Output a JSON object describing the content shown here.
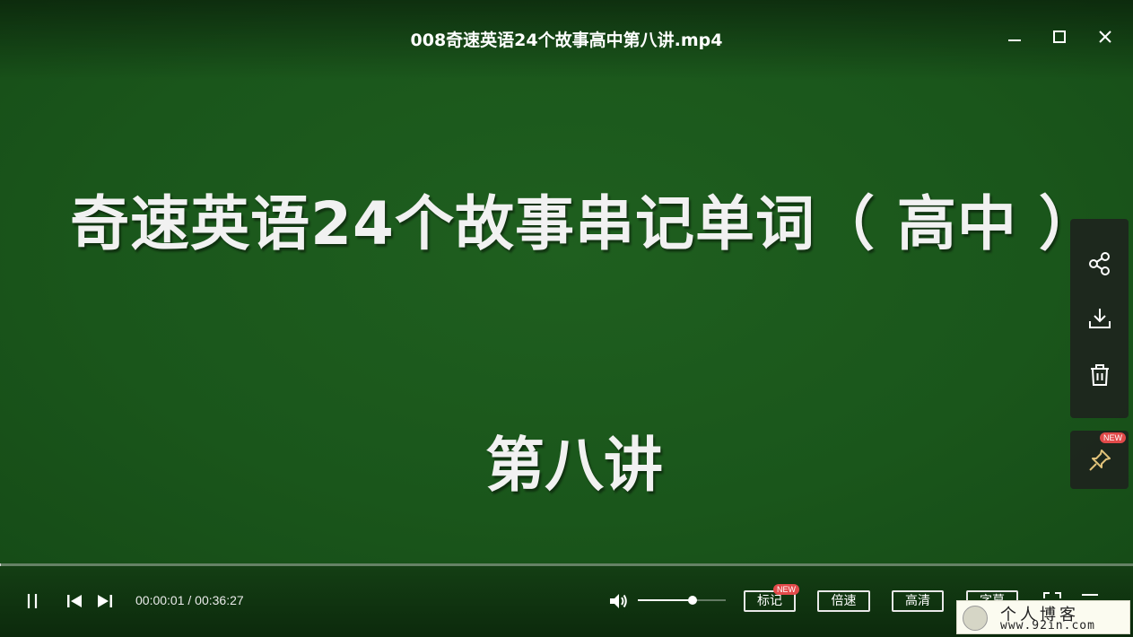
{
  "window": {
    "title": "008奇速英语24个故事高中第八讲.mp4",
    "controls": [
      "minimize-icon",
      "maximize-icon",
      "close-icon"
    ]
  },
  "video": {
    "heading": "奇速英语24个故事串记单词（ 高中 ）",
    "subheading": "第八讲",
    "background_color": "#1b5a1e"
  },
  "side_panel": {
    "actions": [
      "share-icon",
      "download-icon",
      "delete-icon"
    ],
    "pin": {
      "icon": "pin-icon",
      "badge": "NEW"
    }
  },
  "player": {
    "current_time": "00:00:01",
    "separator": " / ",
    "duration": "00:36:27",
    "progress_fraction": 0.0005,
    "volume_fraction": 0.62,
    "buttons": {
      "mark": "标记",
      "mark_badge": "NEW",
      "speed": "倍速",
      "quality": "高清",
      "subtitle": "字幕"
    }
  },
  "watermark": {
    "title": "个人博客",
    "url": "www.92in.com"
  }
}
